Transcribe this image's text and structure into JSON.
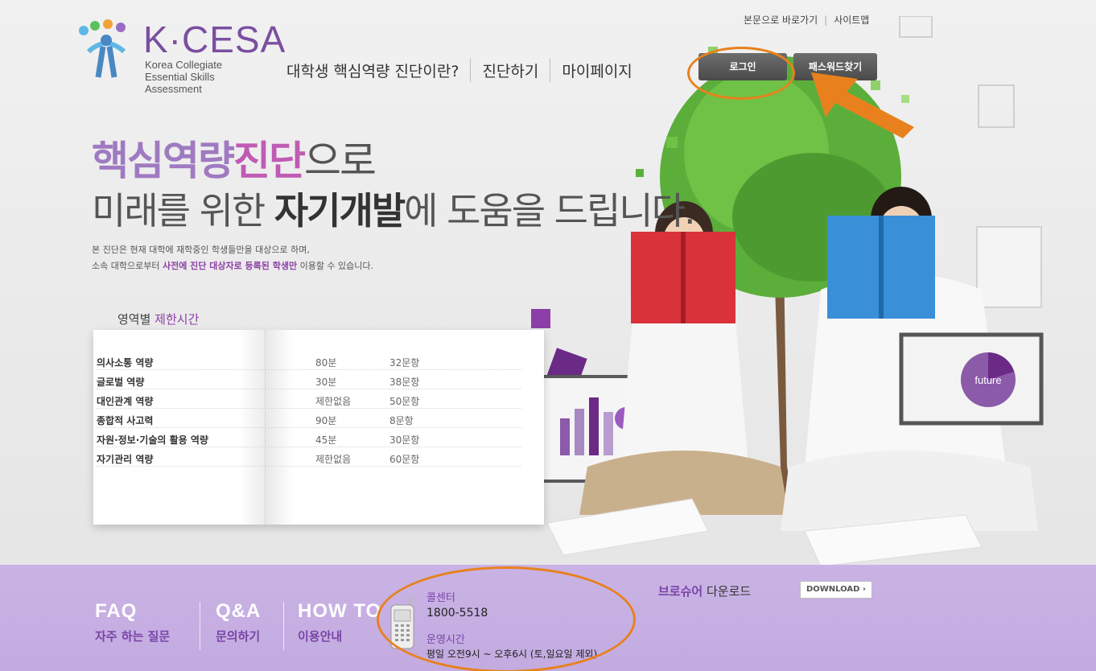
{
  "header": {
    "logo_title": "K·CESA",
    "logo_sub1": "Korea Collegiate",
    "logo_sub2": "Essential Skills Assessment",
    "nav": [
      "대학생 핵심역량 진단이란?",
      "진단하기",
      "마이페이지"
    ],
    "toplinks": {
      "skip": "본문으로 바로가기",
      "sitemap": "사이트맵",
      "sep": "|"
    },
    "login_label": "로그인",
    "password_label": "패스워드찾기"
  },
  "hero": {
    "headline1_a": "핵심역량",
    "headline1_b": "진단",
    "headline1_c": "으로",
    "headline2_a": "미래를 위한 ",
    "headline2_b": "자기개발",
    "headline2_c": "에 도움을 드립니다.",
    "intro1": "본 진단은 현재 대학에 재학중인 학생들만을 대상으로 하며,",
    "intro2_a": "소속 대학으로부터 ",
    "intro2_b": "사전에 진단 대상자로 등록된 학생만",
    "intro2_c": " 이용할 수 있습니다."
  },
  "timetable": {
    "title_a": "영역별 ",
    "title_b": "제한시간",
    "rows": [
      {
        "name": "의사소통 역량",
        "time": "80분",
        "questions": "32문항"
      },
      {
        "name": "글로벌 역량",
        "time": "30분",
        "questions": "38문항"
      },
      {
        "name": "대인관계 역량",
        "time": "제한없음",
        "questions": "50문항"
      },
      {
        "name": "종합적 사고력",
        "time": "90분",
        "questions": "8문항"
      },
      {
        "name": "자원·정보·기술의 활용 역량",
        "time": "45분",
        "questions": "30문항"
      },
      {
        "name": "자기관리 역량",
        "time": "제한없음",
        "questions": "60문항"
      }
    ]
  },
  "illustration": {
    "future_label": "future"
  },
  "footer": {
    "faq_en": "FAQ",
    "faq_ko": "자주 하는 질문",
    "qna_en": "Q&A",
    "qna_ko": "문의하기",
    "howto_en": "HOW TO",
    "howto_ko": "이용안내",
    "call_title": "콜센터",
    "call_number": "1800-5518",
    "hours_title": "운영시간",
    "hours_value": "평일 오전9시 ~ 오후6시 (토,일요일 제외)",
    "brochure_a": "브로슈어",
    "brochure_b": " 다운로드",
    "download_label": "DOWNLOAD ›"
  },
  "colors": {
    "accent_purple": "#7a44a8",
    "highlight_orange": "#e8811d",
    "footer_bg": "#c9b3e4"
  }
}
